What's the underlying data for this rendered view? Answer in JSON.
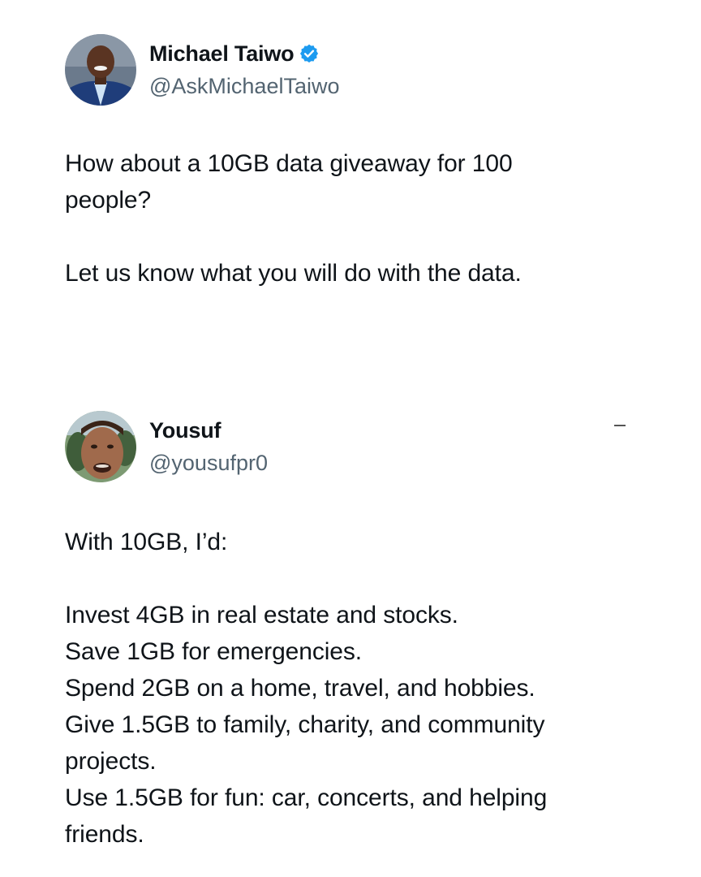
{
  "tweets": [
    {
      "display_name": "Michael Taiwo",
      "handle": "@AskMichaelTaiwo",
      "verified": true,
      "avatar_icon": "avatar-man-suit",
      "text": "How about a 10GB data giveaway for 100\npeople?\n\nLet us know what you will do with the data."
    },
    {
      "display_name": "Yousuf",
      "handle": "@yousufpr0",
      "verified": false,
      "avatar_icon": "avatar-face-closeup",
      "text": "With 10GB, I’d:\n\nInvest 4GB in real estate and stocks.\nSave 1GB for emergencies.\nSpend 2GB on a home, travel, and hobbies.\nGive 1.5GB to family, charity, and community\nprojects.\nUse 1.5GB for fun: car, concerts, and helping\nfriends."
    }
  ],
  "colors": {
    "text": "#0f1419",
    "handle": "#536471",
    "verified": "#1d9bf0"
  }
}
